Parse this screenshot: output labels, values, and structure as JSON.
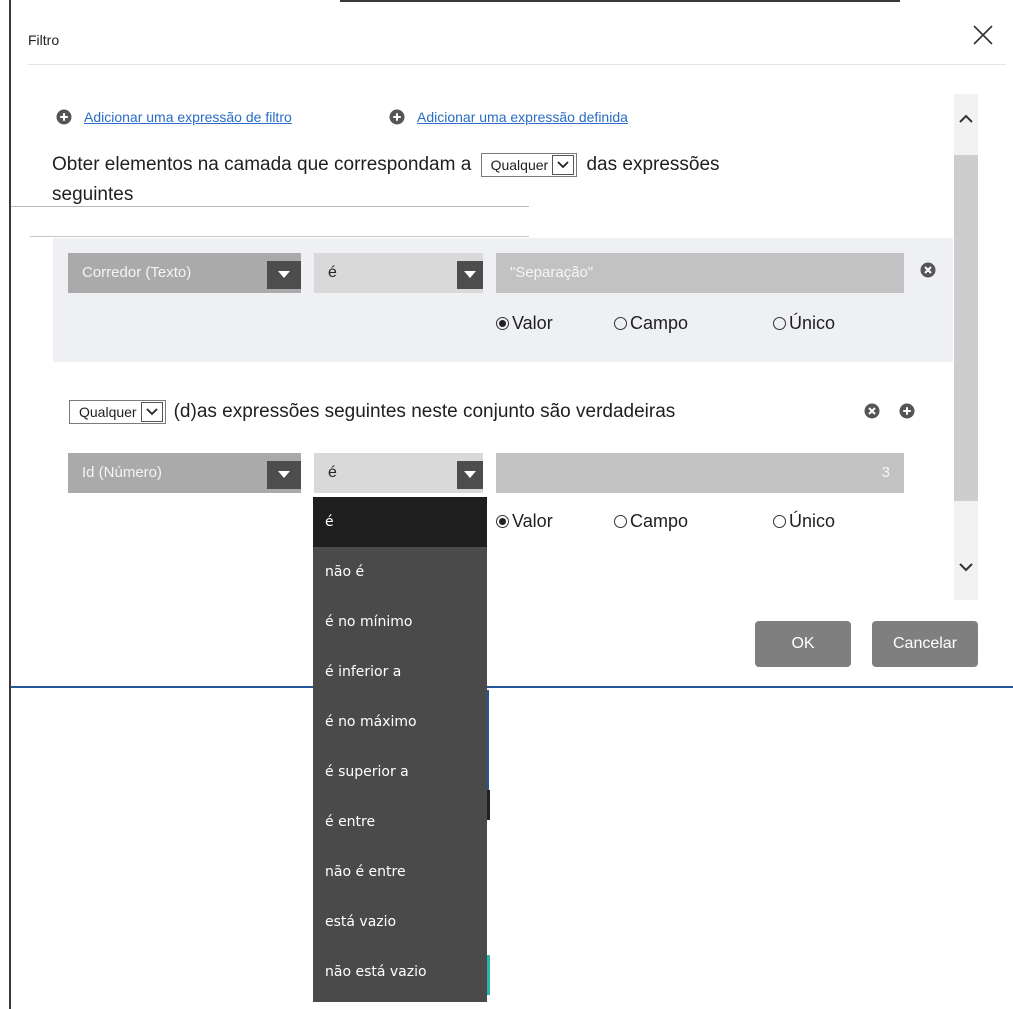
{
  "dialog": {
    "title": "Filtro"
  },
  "actions": {
    "add_filter_expression": "Adicionar uma expressão de filtro",
    "add_set_expression": "Adicionar uma expressão definida"
  },
  "intro": {
    "before": "Obter elementos na camada que correspondam a",
    "match_select": "Qualquer",
    "after": "das expressões",
    "line2": "seguintes"
  },
  "expression1": {
    "field": "Corredor (Texto)",
    "operator": "é",
    "value": "\"Separação\"",
    "value_type_options": [
      "Valor",
      "Campo",
      "Único"
    ],
    "value_type_selected": "Valor"
  },
  "set": {
    "match_select": "Qualquer",
    "text": "(d)as expressões seguintes neste conjunto são verdadeiras"
  },
  "expression2": {
    "field": "Id (Número)",
    "operator": "é",
    "value": "3",
    "value_type_options": [
      "Valor",
      "Campo",
      "Único"
    ],
    "value_type_selected": "Valor"
  },
  "operator_dropdown": {
    "options": [
      "é",
      "não é",
      "é no mínimo",
      "é inferior a",
      "é no máximo",
      "é superior a",
      "é entre",
      "não é entre",
      "está vazio",
      "não está vazio"
    ],
    "selected_index": 0
  },
  "buttons": {
    "ok": "OK",
    "cancel": "Cancelar"
  },
  "colors": {
    "link": "#2a6cc6",
    "button": "#7f7f7f",
    "dropdown_bg": "#4a4a4a",
    "dropdown_selected": "#1e1e1e",
    "accent_rule": "#25569b"
  },
  "icons": {
    "add": "plus-circle-icon",
    "remove": "x-circle-icon",
    "close": "close-icon",
    "scroll_up": "chevron-up-icon",
    "scroll_down": "chevron-down-icon",
    "select_arrow": "caret-down-icon"
  }
}
